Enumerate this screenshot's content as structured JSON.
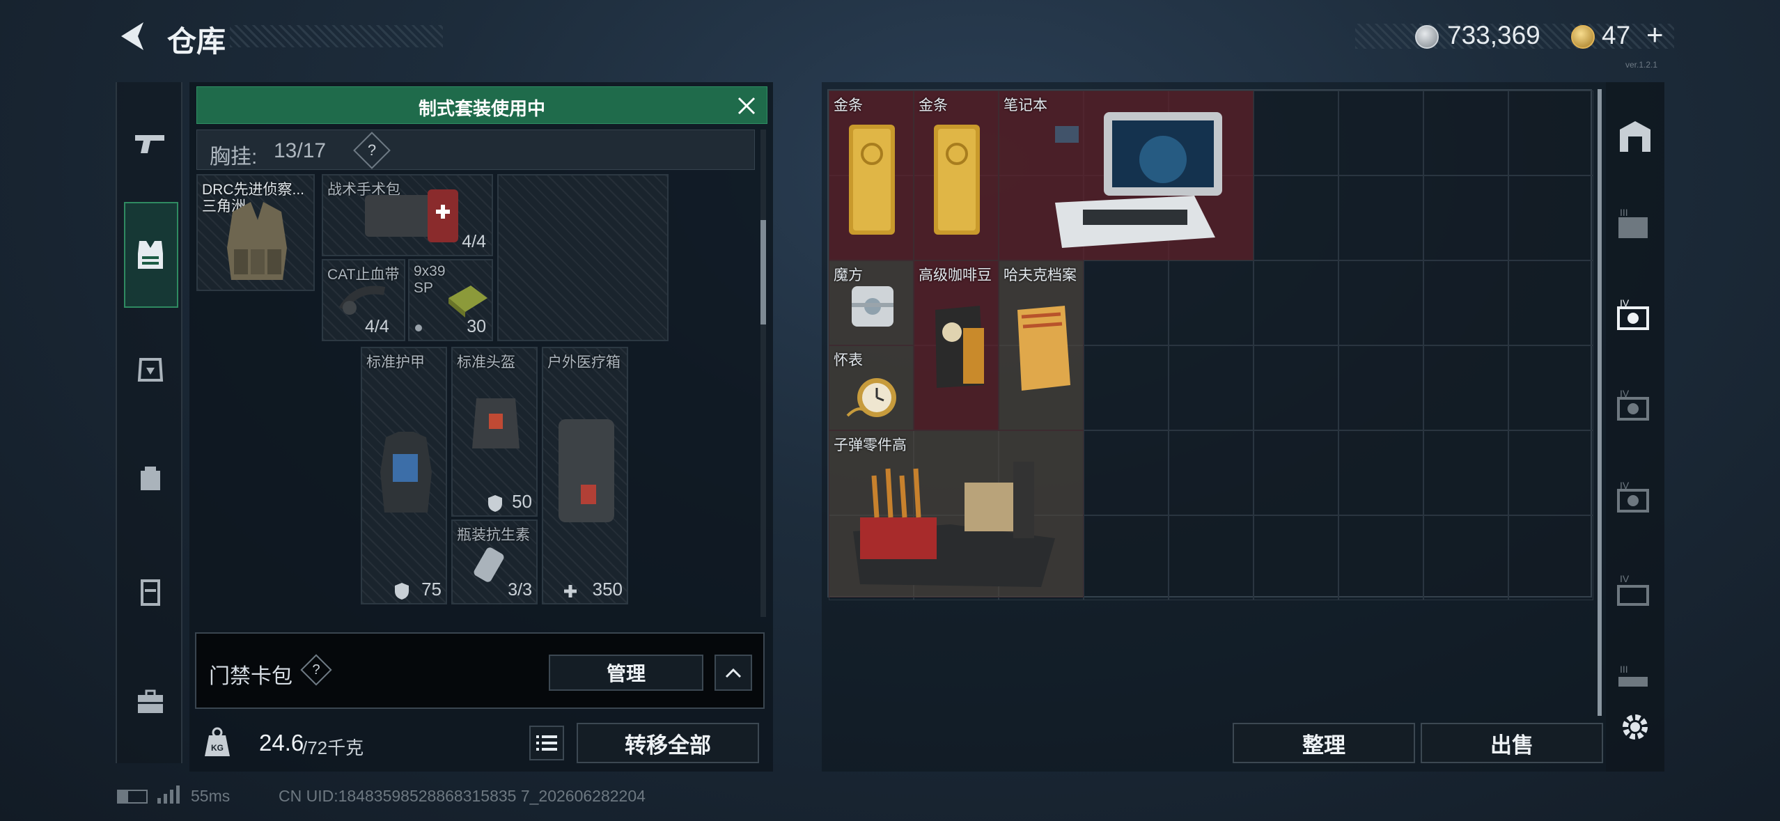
{
  "header": {
    "title": "仓库"
  },
  "currency": {
    "silver": "733,369",
    "gold": "47",
    "add": "+"
  },
  "loadout_banner": "制式套装使用中",
  "chest_rig": {
    "label": "胸挂:",
    "value": "13/17",
    "help": "?"
  },
  "equipment": [
    {
      "name": "DRC先进侦察...",
      "sub": "三角洲"
    },
    {
      "name": "战术手术包",
      "count": "4/4"
    },
    {
      "name": "CAT止血带",
      "count": "4/4"
    },
    {
      "name": "9x39 SP",
      "count": "30"
    },
    {
      "name": "标准护甲",
      "stat": "75"
    },
    {
      "name": "标准头盔",
      "stat": "50"
    },
    {
      "name": "瓶装抗生素",
      "count": "3/3"
    },
    {
      "name": "户外医疗箱",
      "stat": "350"
    }
  ],
  "card_pack": {
    "label": "门禁卡包",
    "help": "?",
    "manage": "管理"
  },
  "weight": {
    "value": "24.6",
    "max": "/72千克",
    "icon": "KG"
  },
  "buttons": {
    "transfer_all": "转移全部",
    "sort": "整理",
    "sell": "出售"
  },
  "storage_items": [
    {
      "name": "金条"
    },
    {
      "name": "金条"
    },
    {
      "name": "笔记本"
    },
    {
      "name": "魔方"
    },
    {
      "name": "高级咖啡豆"
    },
    {
      "name": "哈夫克档案"
    },
    {
      "name": "怀表"
    },
    {
      "name": "子弹零件高"
    }
  ],
  "status": {
    "ping": "55ms",
    "uid": "CN UID:18483598528868315835 7_202606282204"
  },
  "version": "ver.1.2.1"
}
